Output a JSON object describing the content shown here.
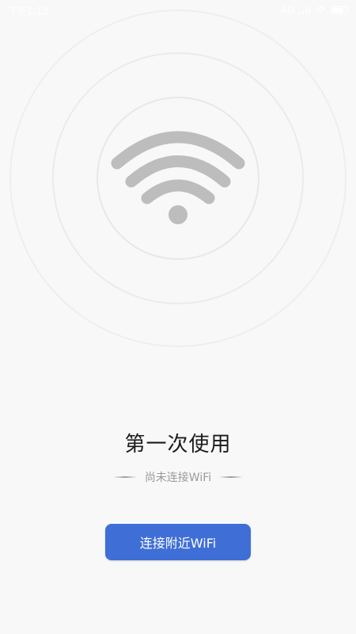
{
  "status_bar": {
    "time": "下午1:13",
    "network": "4G",
    "battery": "full"
  },
  "hero": {
    "icon": "wifi-icon",
    "icon_color": "#bdbdbd",
    "ring_color": "#ebebeb"
  },
  "main": {
    "title": "第一次使用",
    "subtitle": "尚未连接WiFi",
    "connect_button_label": "连接附近WiFi",
    "button_color": "#3f6fd6"
  }
}
